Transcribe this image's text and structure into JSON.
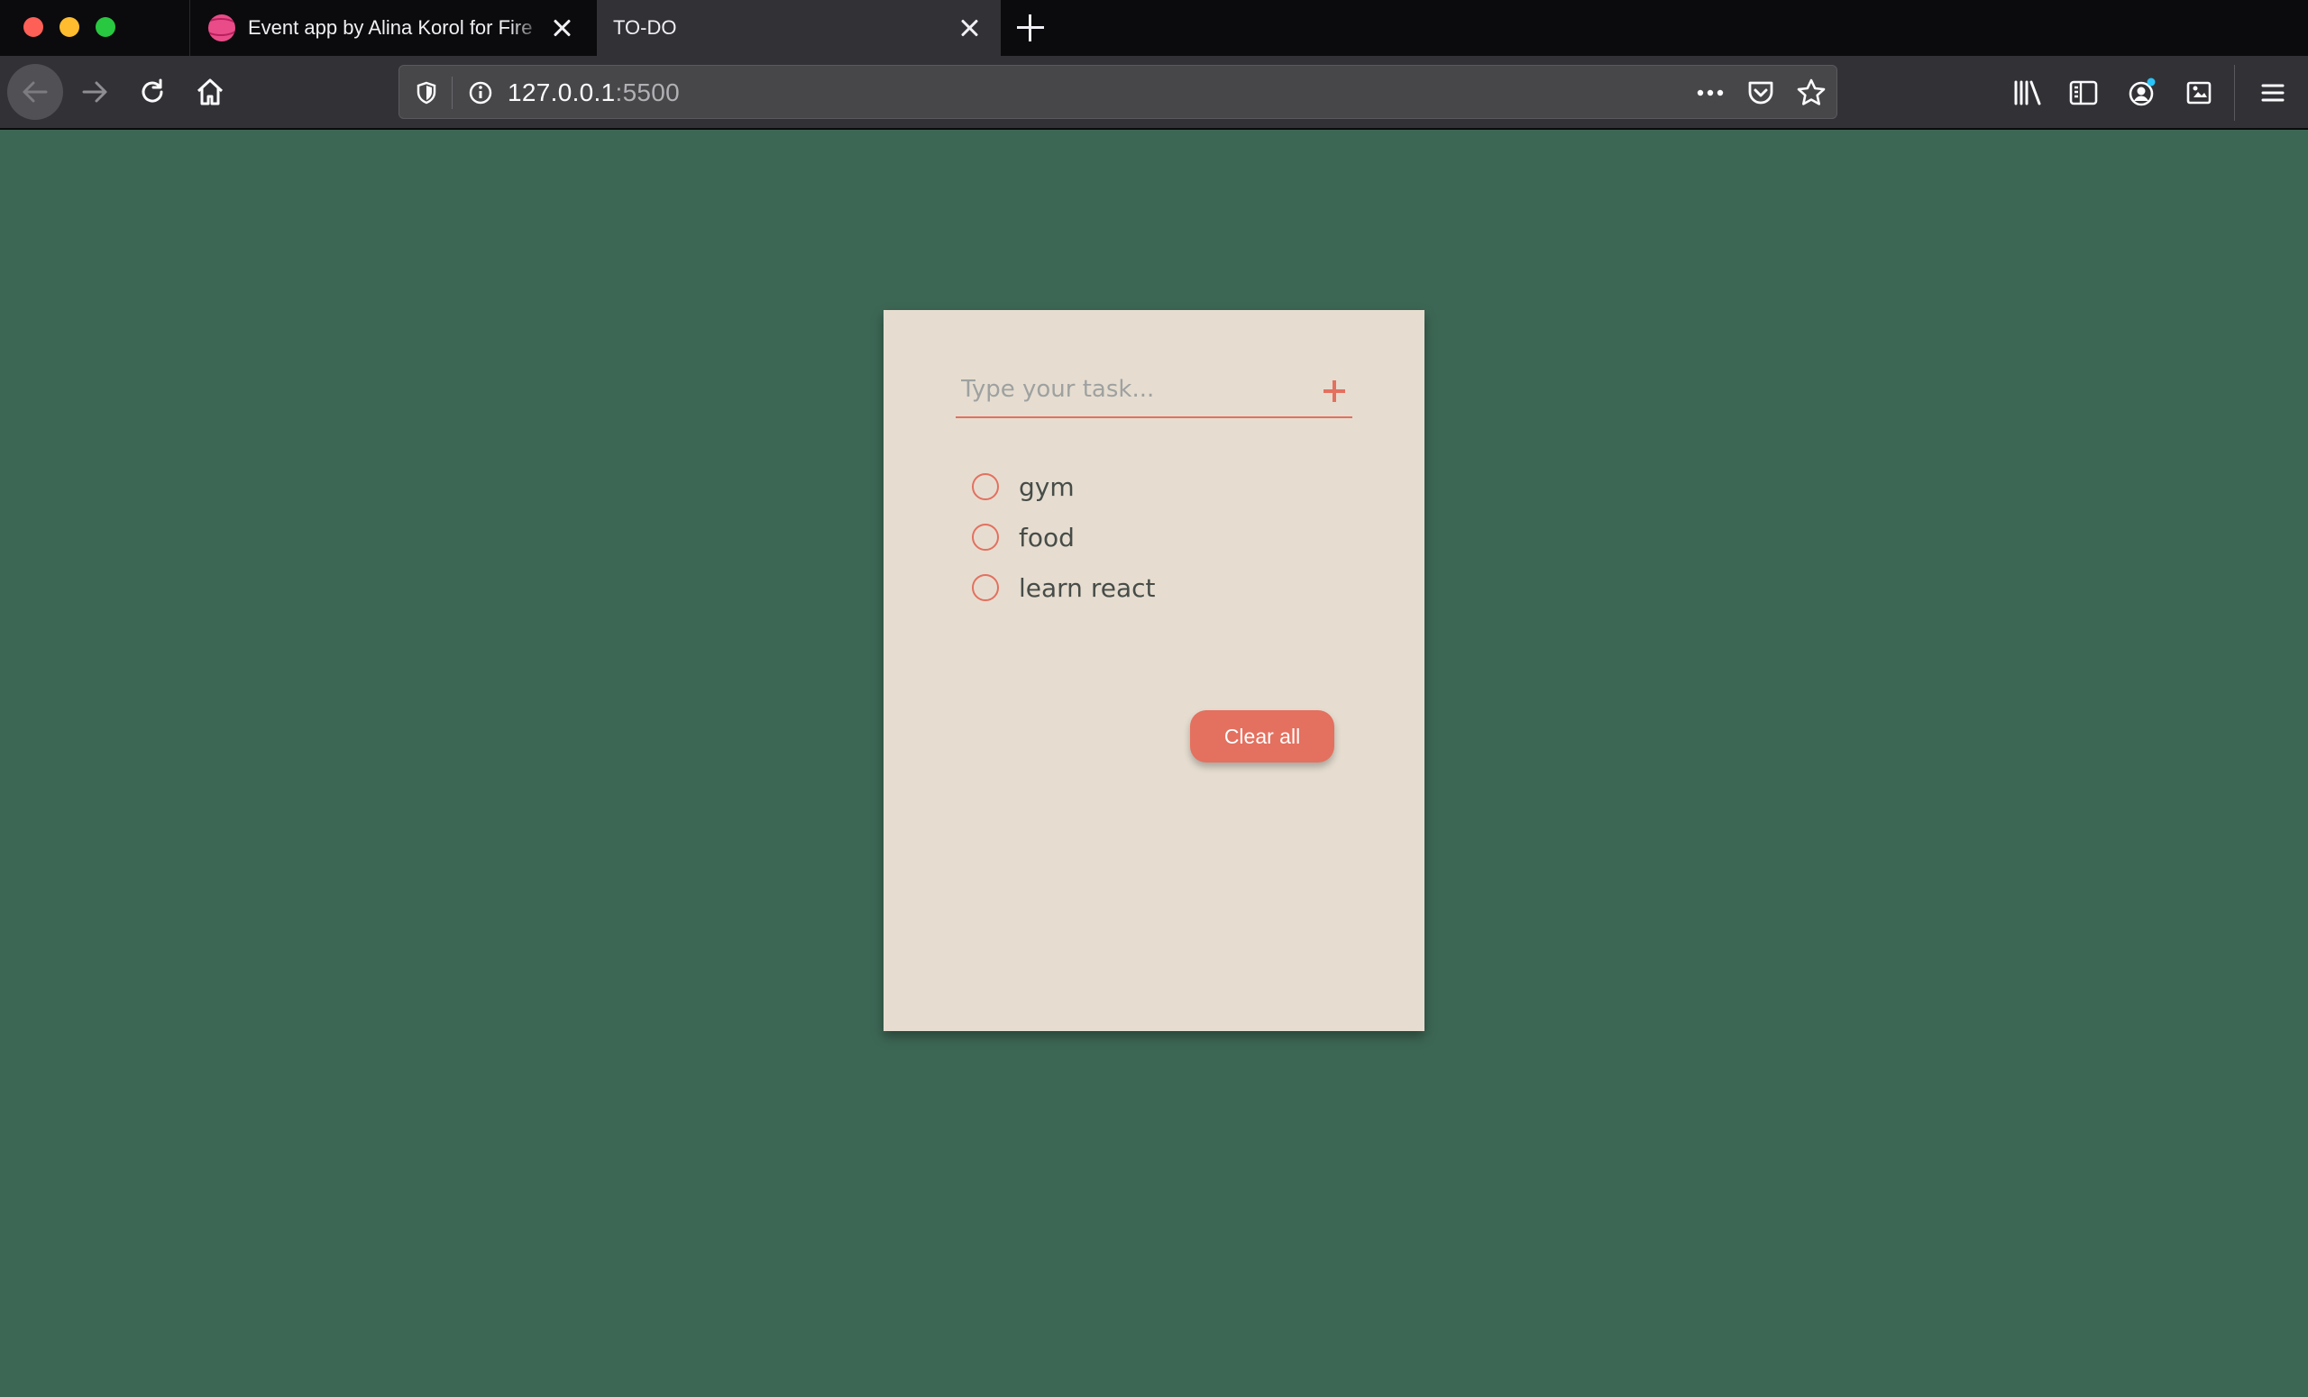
{
  "browser": {
    "tabs": [
      {
        "title": "Event app by Alina Korol for Fire",
        "active": false,
        "favicon": "dribbble-icon"
      },
      {
        "title": "TO-DO",
        "active": true
      }
    ],
    "url": {
      "host": "127.0.0.1",
      "port": ":5500"
    },
    "colors": {
      "tabbar": "#0b0b0d",
      "toolbar": "#323236",
      "urlbar": "#474749"
    }
  },
  "todo": {
    "input_placeholder": "Type your task...",
    "input_value": "",
    "tasks": [
      {
        "label": "gym",
        "done": false
      },
      {
        "label": "food",
        "done": false
      },
      {
        "label": "learn react",
        "done": false
      }
    ],
    "clear_label": "Clear all",
    "colors": {
      "background": "#3d6755",
      "card": "#e6ddd0",
      "accent": "#e4705f",
      "text": "#474c48"
    }
  }
}
